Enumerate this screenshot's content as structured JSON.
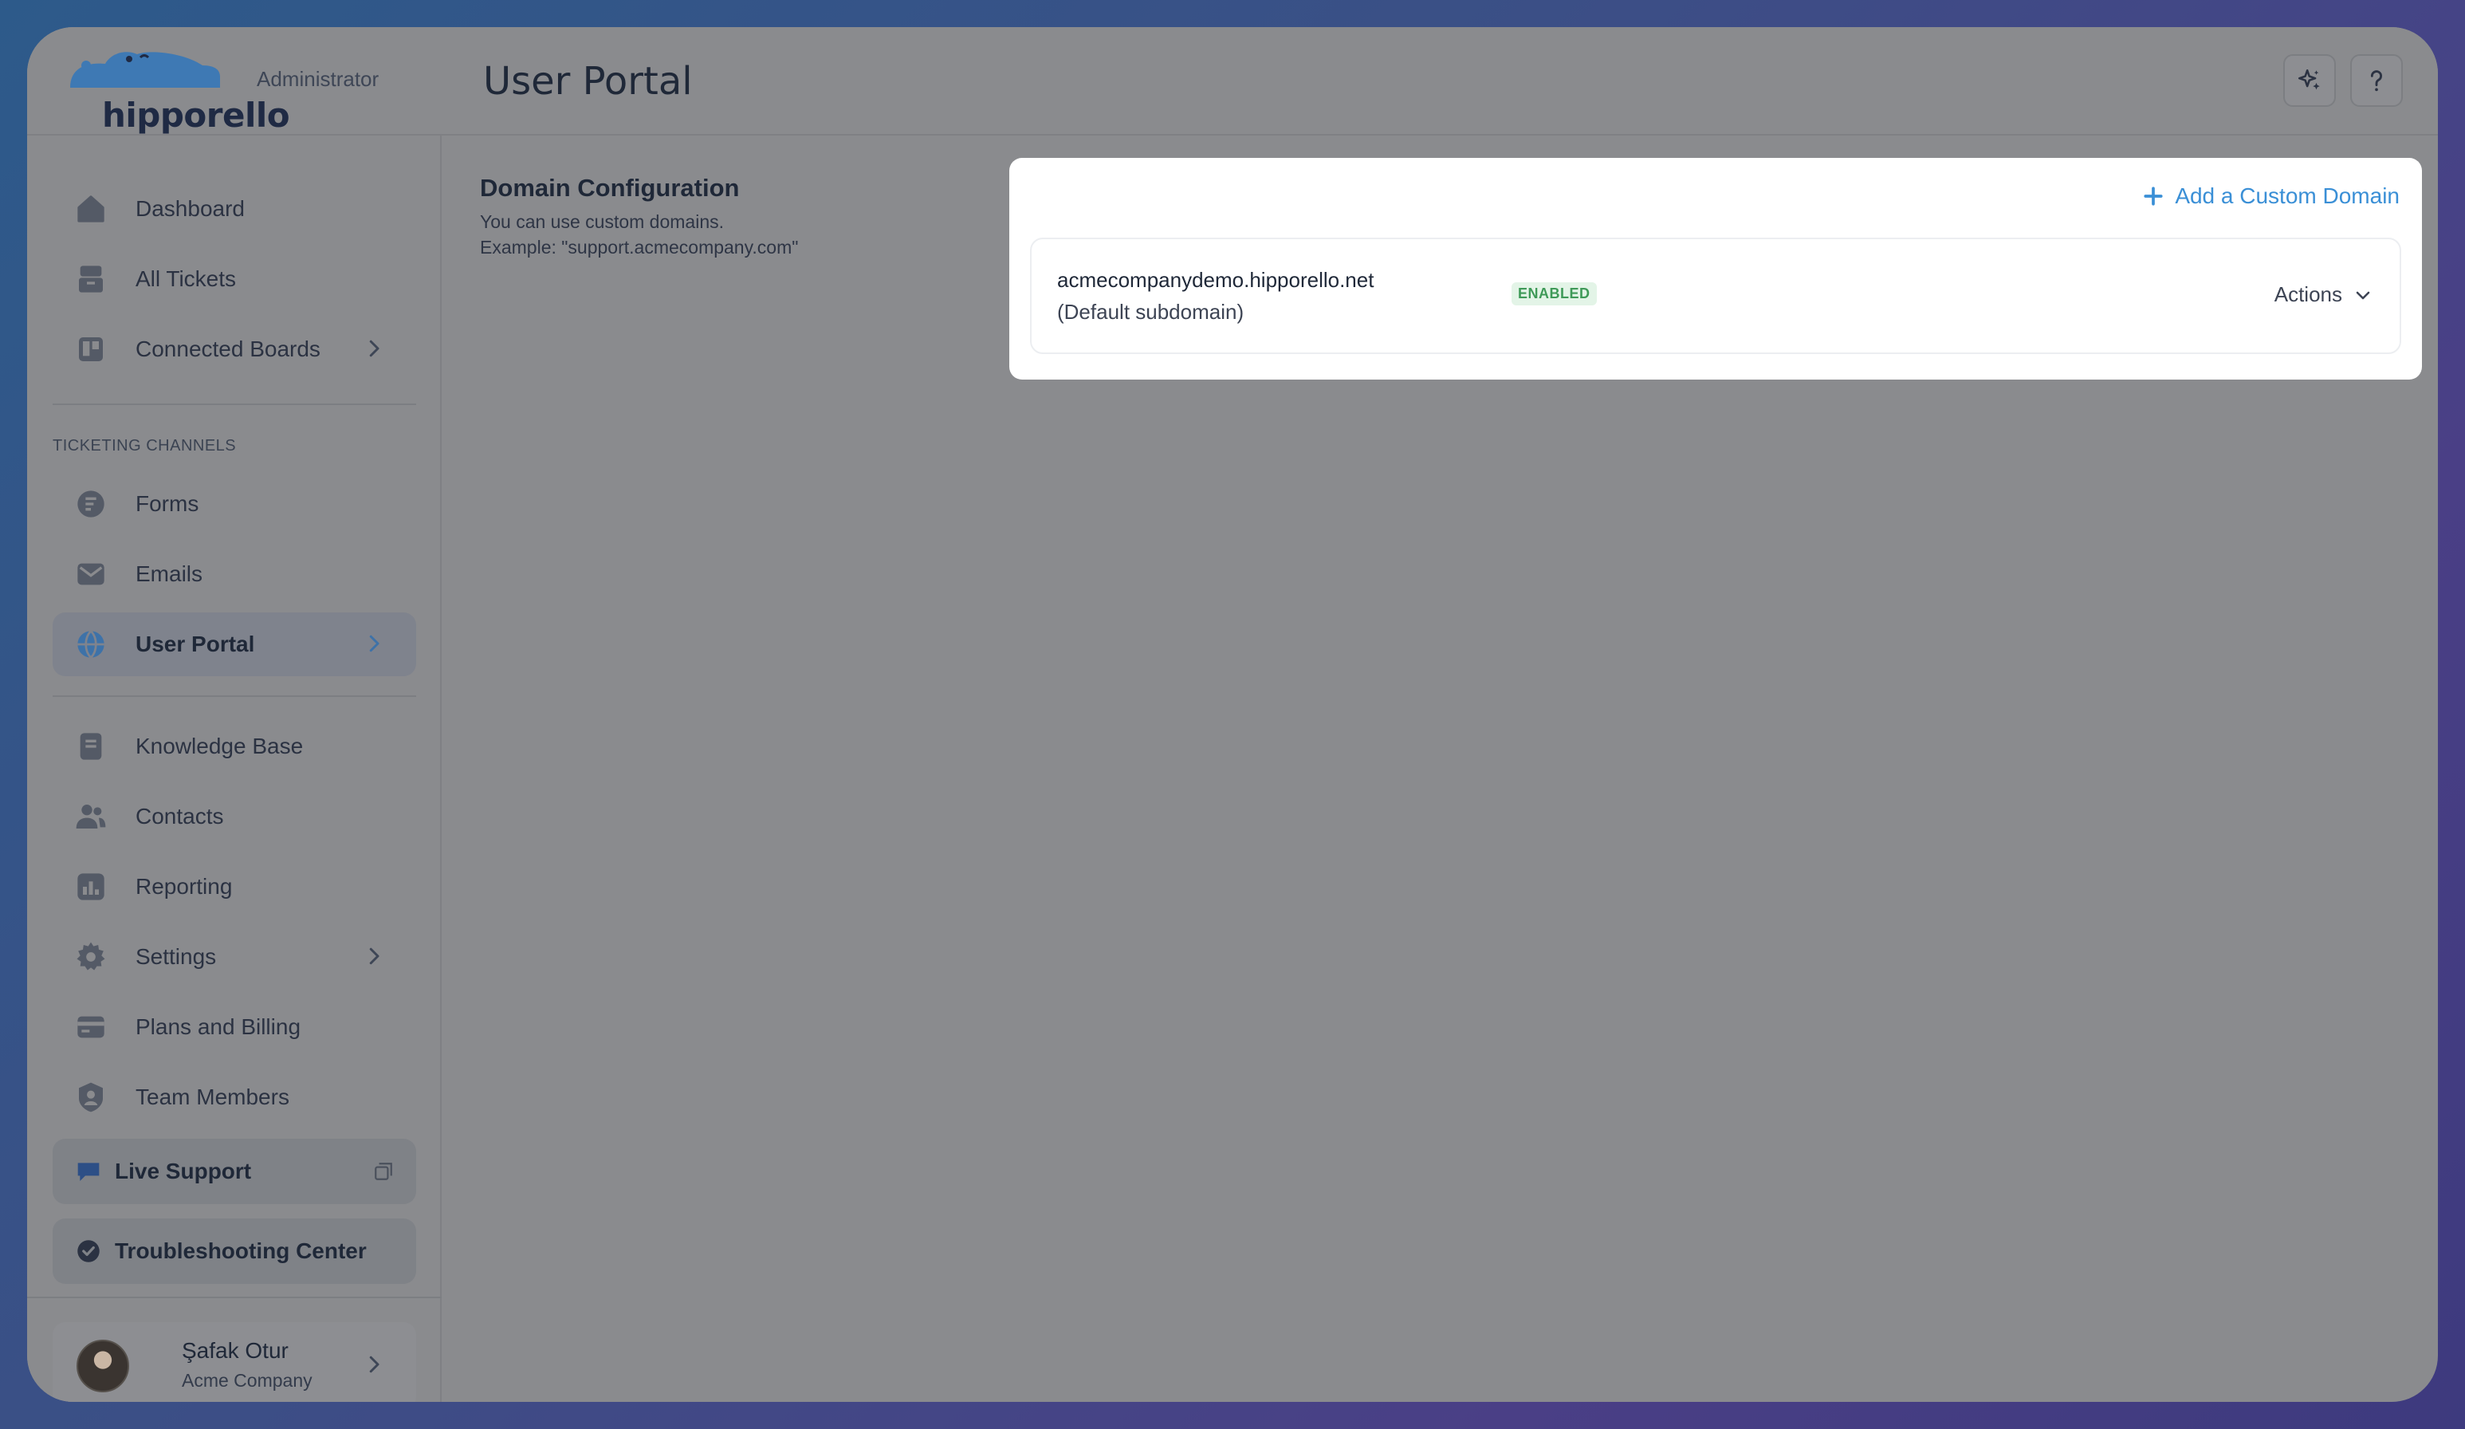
{
  "app": {
    "brand": "hipporello",
    "role": "Administrator",
    "page_title": "User Portal"
  },
  "sidebar": {
    "items_top": [
      {
        "label": "Dashboard",
        "icon": "home-icon"
      },
      {
        "label": "All Tickets",
        "icon": "inbox-icon"
      },
      {
        "label": "Connected Boards",
        "icon": "trello-board-icon",
        "has_chevron": true
      }
    ],
    "section_label": "TICKETING CHANNELS",
    "channels": [
      {
        "label": "Forms",
        "icon": "forms-icon"
      },
      {
        "label": "Emails",
        "icon": "envelope-icon"
      },
      {
        "label": "User Portal",
        "icon": "globe-icon",
        "has_chevron": true,
        "active": true
      }
    ],
    "items_bottom": [
      {
        "label": "Knowledge Base",
        "icon": "book-icon"
      },
      {
        "label": "Contacts",
        "icon": "users-icon"
      },
      {
        "label": "Reporting",
        "icon": "bar-chart-icon"
      },
      {
        "label": "Settings",
        "icon": "gear-icon",
        "has_chevron": true
      },
      {
        "label": "Plans and Billing",
        "icon": "credit-card-icon"
      },
      {
        "label": "Team Members",
        "icon": "user-badge-icon"
      }
    ],
    "live_support": "Live Support",
    "troubleshooting": "Troubleshooting Center",
    "user": {
      "name": "Şafak Otur",
      "org": "Acme Company"
    }
  },
  "main": {
    "section_title": "Domain Configuration",
    "section_desc_1": "You can use custom domains.",
    "section_desc_2": "Example: \"support.acmecompany.com\"",
    "add_domain_label": "Add a Custom Domain",
    "domains": [
      {
        "name": "acmecompanydemo.hipporello.net",
        "note": "(Default subdomain)",
        "status": "ENABLED",
        "actions_label": "Actions"
      }
    ]
  },
  "colors": {
    "accent": "#3a8fd6",
    "enabled_badge_bg": "#e3f4e7",
    "enabled_badge_text": "#3f9a58",
    "overlay": "#8a8b8e"
  }
}
